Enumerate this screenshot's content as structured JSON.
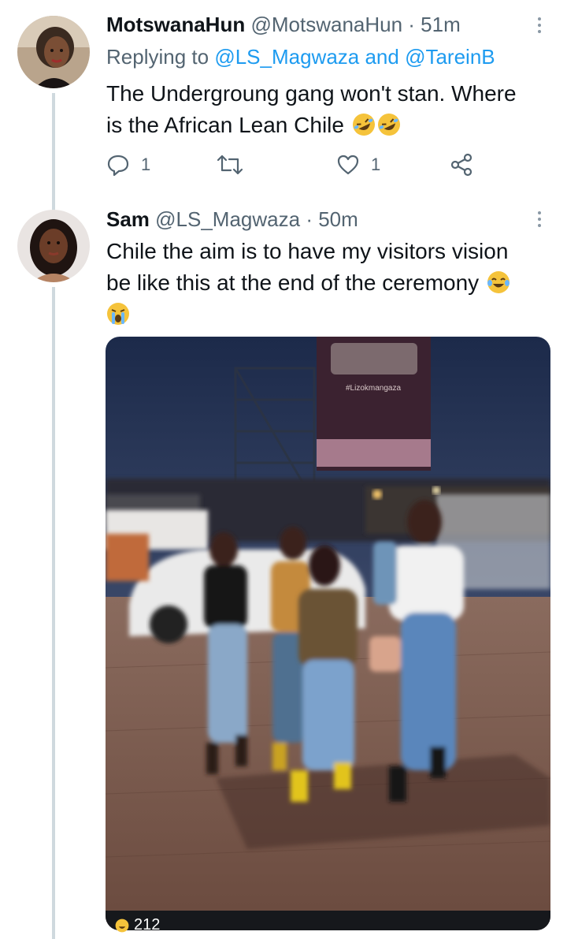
{
  "tweets": [
    {
      "display_name": "MotswanaHun",
      "handle": "@MotswanaHun",
      "time": "· 51m",
      "replying_prefix": "Replying to",
      "replying_to": "@LS_Magwaza and @TareinB",
      "text_line1": "The Undergroung gang won't stan. Where",
      "text_line2": "is the African Lean Chile",
      "text_emojis": [
        "rofl-emoji",
        "rofl-emoji"
      ],
      "reply_count": "1",
      "retweet_count": "",
      "like_count": "1"
    },
    {
      "display_name": "Sam",
      "handle": "@LS_Magwaza",
      "time": "· 50m",
      "text_line1": "Chile the aim is to have my visitors vision",
      "text_line2": "be like this at the end of the ceremony",
      "text_emojis": [
        "joy-emoji",
        "loudly-crying-emoji"
      ],
      "media_sign_text": "#Lizokmangaza",
      "media_counter": "212"
    }
  ],
  "colors": {
    "text": "#0f1419",
    "secondary": "#536471",
    "link": "#1d9bf0",
    "thread_line": "#cfd9de"
  }
}
